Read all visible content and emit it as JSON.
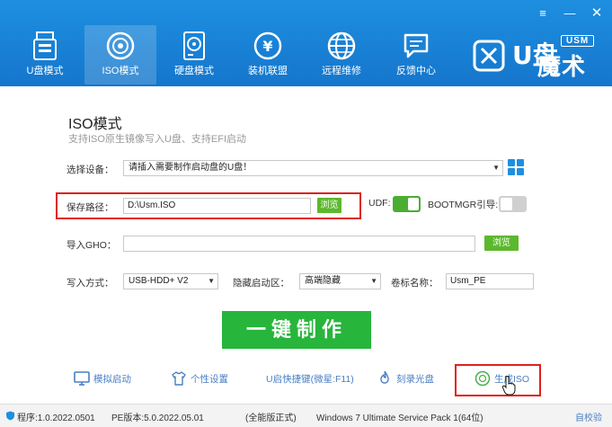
{
  "window": {
    "menu_icon": "≡",
    "minimize_icon": "—",
    "close_icon": "✕"
  },
  "nav": [
    {
      "label": "U盘模式",
      "icon": "usb-drive-icon"
    },
    {
      "label": "ISO模式",
      "icon": "disc-icon"
    },
    {
      "label": "硬盘模式",
      "icon": "hard-disk-icon"
    },
    {
      "label": "装机联盟",
      "icon": "yuan-coin-icon"
    },
    {
      "label": "远程维修",
      "icon": "globe-icon"
    },
    {
      "label": "反馈中心",
      "icon": "chat-icon"
    }
  ],
  "logo": {
    "u_text": "U盘",
    "badge": "USM",
    "name": "魔术师"
  },
  "page": {
    "title": "ISO模式",
    "subtitle": "支持ISO原生镜像写入U盘、支持EFI启动"
  },
  "device": {
    "label": "选择设备：",
    "value": "请插入需要制作启动盘的U盘！"
  },
  "save_path": {
    "label": "保存路径：",
    "value": "D:\\Usm.ISO",
    "browse": "浏览"
  },
  "udf": {
    "label": "UDF:",
    "state": "on"
  },
  "bootmgr": {
    "label": "BOOTMGR引导:",
    "state": "off"
  },
  "gho": {
    "label": "导入GHO：",
    "value": "",
    "browse": "浏览"
  },
  "write_mode": {
    "label": "写入方式：",
    "value": "USB-HDD+ V2"
  },
  "hide_partition": {
    "label": "隐藏启动区：",
    "value": "高端隐藏"
  },
  "volume_label": {
    "label": "卷标名称：",
    "value": "Usm_PE"
  },
  "make_button": "一键制作",
  "tools": [
    {
      "label": "模拟启动",
      "icon": "monitor-icon"
    },
    {
      "label": "个性设置",
      "icon": "tshirt-icon"
    },
    {
      "label": "U启快捷键(微星:F11)",
      "icon": ""
    },
    {
      "label": "刻录光盘",
      "icon": "flame-icon"
    },
    {
      "label": "生成ISO",
      "icon": "disc-icon"
    }
  ],
  "footer": {
    "program_version": "程序:1.0.2022.0501",
    "pe_version": "PE版本:5.0.2022.05.01",
    "edition": "(全能版正式)",
    "os": "Windows 7 Ultimate Service Pack 1(64位)",
    "self_check": "自校验"
  },
  "colors": {
    "header": "#1576cc",
    "accent_green": "#27b53c",
    "highlight_red": "#e0201a",
    "link_blue": "#4a7fc2"
  }
}
